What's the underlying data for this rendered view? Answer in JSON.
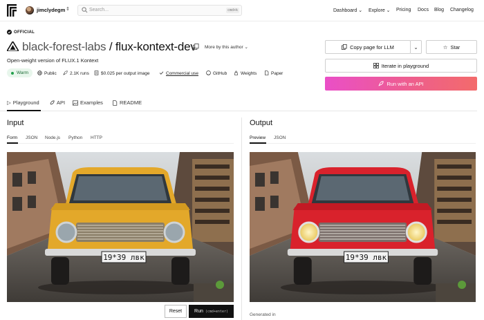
{
  "user": {
    "name": "jimclydegm"
  },
  "search": {
    "placeholder": "Search...",
    "shortcut": "cmd+k"
  },
  "nav": [
    {
      "label": "Dashboard ⌄"
    },
    {
      "label": "Explore ⌄"
    },
    {
      "label": "Pricing"
    },
    {
      "label": "Docs"
    },
    {
      "label": "Blog"
    },
    {
      "label": "Changelog"
    }
  ],
  "model": {
    "badge": "OFFICIAL",
    "owner": "black-forest-labs",
    "separator": "/",
    "name": "flux-kontext-dev",
    "more_by_author": "More by this author",
    "description": "Open-weight version of FLUX.1 Kontext",
    "status": "Warm",
    "meta": {
      "visibility": "Public",
      "runs": "2.1K runs",
      "price": "$0.025 per output image",
      "license": "Commercial use",
      "github": "GitHub",
      "weights": "Weights",
      "paper": "Paper"
    }
  },
  "actions": {
    "copy_page": "Copy page for LLM",
    "star": "Star",
    "iterate": "Iterate in playground",
    "run_api": "Run with an API"
  },
  "tabs": {
    "playground": "Playground",
    "api": "API",
    "examples": "Examples",
    "readme": "README"
  },
  "input": {
    "heading": "Input",
    "subtabs": [
      "Form",
      "JSON",
      "Node.js",
      "Python",
      "HTTP"
    ],
    "plate": "19*39 лвк",
    "car_color": "#e3a82a"
  },
  "output": {
    "heading": "Output",
    "subtabs": [
      "Preview",
      "JSON"
    ],
    "plate": "19*39 лвк",
    "car_color": "#d9222c",
    "generated": "Generated in"
  },
  "buttons": {
    "reset": "Reset",
    "run": "Run",
    "run_shortcut": "(cmd+enter)"
  },
  "colors": {
    "accent_gradient_start": "#ea4fc7",
    "accent_gradient_end": "#f36b6b",
    "warm": "#22a04b"
  }
}
